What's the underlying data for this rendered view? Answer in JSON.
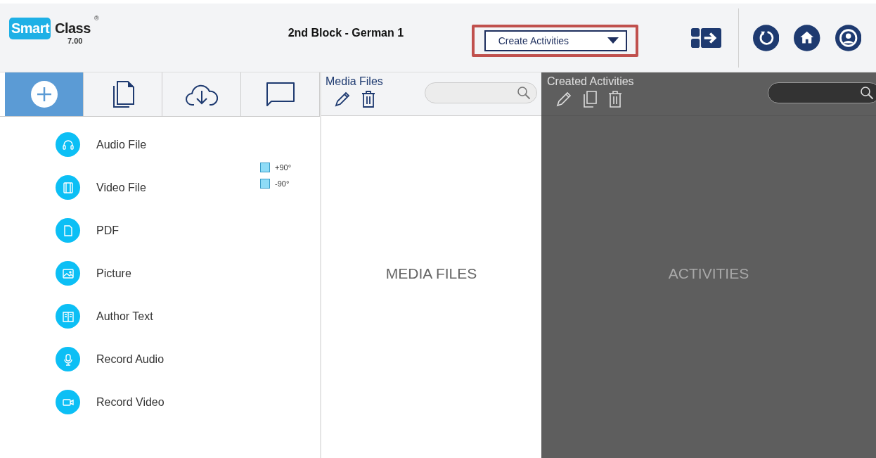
{
  "logo": {
    "word_1": "Smart",
    "word_2": "Class",
    "mark": "®",
    "version": "7.00"
  },
  "title": "2nd Block - German 1",
  "activity_select": {
    "value": "Create Activities"
  },
  "tabs": [
    {
      "kind": "add",
      "selected": true
    },
    {
      "kind": "copy",
      "selected": false
    },
    {
      "kind": "download",
      "selected": false
    },
    {
      "kind": "chat",
      "selected": false
    }
  ],
  "media_types": [
    {
      "kind": "audio",
      "label": "Audio File"
    },
    {
      "kind": "video",
      "label": "Video File"
    },
    {
      "kind": "pdf",
      "label": "PDF"
    },
    {
      "kind": "picture",
      "label": "Picture"
    },
    {
      "kind": "text",
      "label": "Author Text"
    },
    {
      "kind": "mic",
      "label": "Record Audio"
    },
    {
      "kind": "camera",
      "label": "Record Video"
    }
  ],
  "rotate_options": [
    {
      "label": "+90°",
      "checked": false
    },
    {
      "label": "-90°",
      "checked": false
    }
  ],
  "media_panel": {
    "title": "Media Files",
    "empty_label": "MEDIA FILES"
  },
  "activities_panel": {
    "title": "Created Activities",
    "empty_label": "ACTIVITIES"
  }
}
